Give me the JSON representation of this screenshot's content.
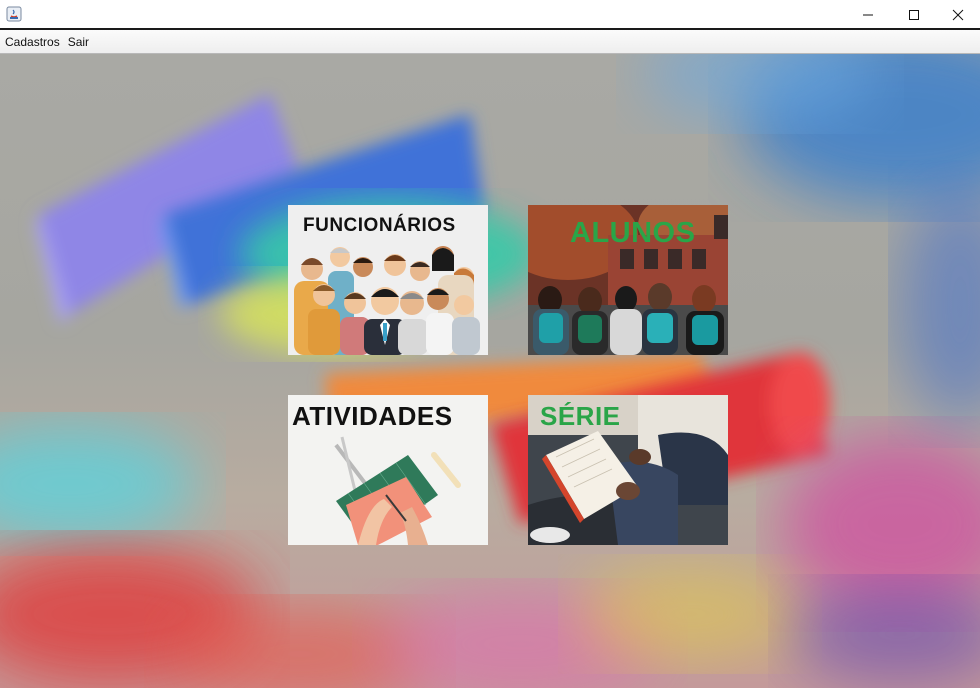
{
  "window": {
    "title": "",
    "controls": {
      "minimize": "minimize",
      "maximize": "maximize",
      "close": "close"
    }
  },
  "menu": {
    "items": [
      {
        "label": "Cadastros"
      },
      {
        "label": "Sair"
      }
    ]
  },
  "tiles": [
    {
      "label": "FUNCIONÁRIOS",
      "label_color": "#111111"
    },
    {
      "label": "ALUNOS",
      "label_color": "#2aa548"
    },
    {
      "label": "ATIVIDADES",
      "label_color": "#111111"
    },
    {
      "label": "SÉRIE",
      "label_color": "#2aa548"
    }
  ],
  "colors": {
    "accent_green": "#2aa548",
    "title_border": "#1a1a1a"
  }
}
